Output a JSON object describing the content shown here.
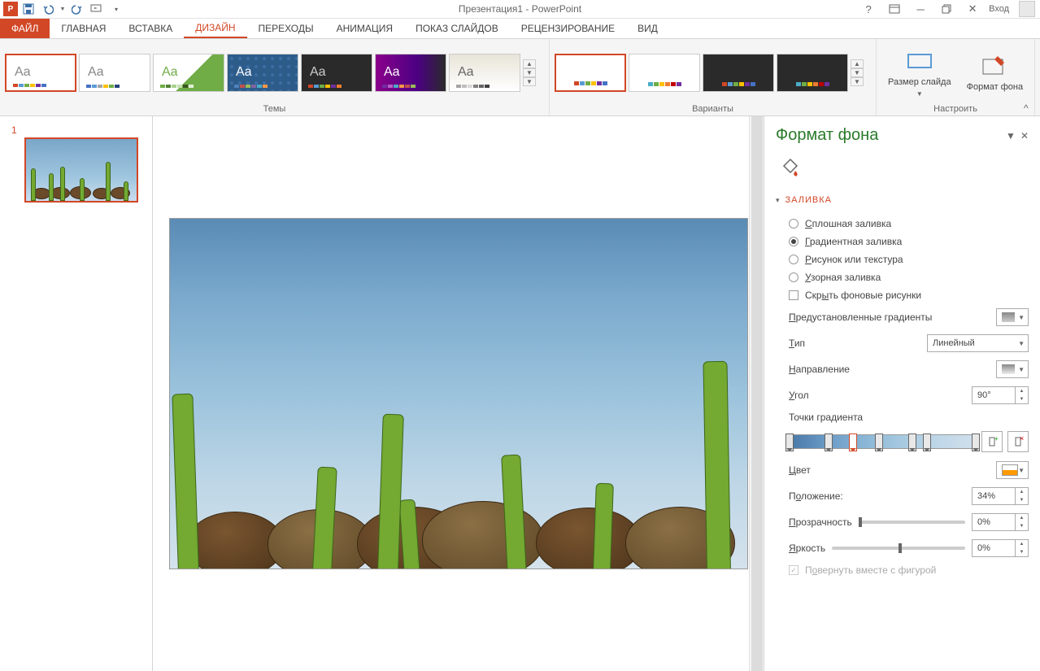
{
  "title": "Презентация1 - PowerPoint",
  "login": "Вход",
  "tabs": {
    "file": "ФАЙЛ",
    "home": "ГЛАВНАЯ",
    "insert": "ВСТАВКА",
    "design": "ДИЗАЙН",
    "transitions": "ПЕРЕХОДЫ",
    "animations": "АНИМАЦИЯ",
    "slideshow": "ПОКАЗ СЛАЙДОВ",
    "review": "РЕЦЕНЗИРОВАНИЕ",
    "view": "ВИД"
  },
  "ribbon": {
    "themes_label": "Темы",
    "variants_label": "Варианты",
    "customize_label": "Настроить",
    "slide_size": "Размер слайда",
    "format_bg": "Формат фона"
  },
  "slide_number": "1",
  "panel": {
    "title": "Формат фона",
    "section_fill": "ЗАЛИВКА",
    "fill_solid": "Сплошная заливка",
    "fill_gradient": "Градиентная заливка",
    "fill_picture": "Рисунок или текстура",
    "fill_pattern": "Узорная заливка",
    "hide_bg": "Скрыть фоновые рисунки",
    "preset_gradients": "Предустановленные градиенты",
    "type": "Тип",
    "type_value": "Линейный",
    "direction": "Направление",
    "angle": "Угол",
    "angle_value": "90°",
    "gradient_stops": "Точки градиента",
    "color": "Цвет",
    "position": "Положение:",
    "position_value": "34%",
    "transparency": "Прозрачность",
    "transparency_value": "0%",
    "brightness": "Яркость",
    "brightness_value": "0%",
    "rotate_with_shape": "Повернуть вместе с фигурой"
  }
}
